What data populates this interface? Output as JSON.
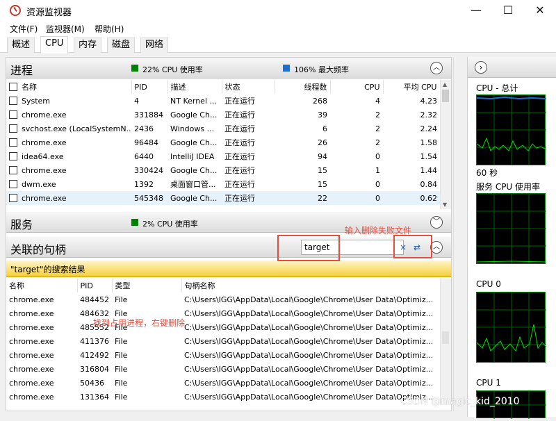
{
  "window": {
    "title": "资源监视器",
    "minimize": "—",
    "maximize": "☐",
    "close": "✕"
  },
  "menu": [
    "文件(F)",
    "监视器(M)",
    "帮助(H)"
  ],
  "tabs": [
    "概述",
    "CPU",
    "内存",
    "磁盘",
    "网络"
  ],
  "active_tab": "CPU",
  "process": {
    "title": "进程",
    "legend1": "22% CPU 使用率",
    "legend2": "106% 最大频率",
    "columns": [
      "名称",
      "PID",
      "描述",
      "状态",
      "线程数",
      "CPU",
      "平均 CPU"
    ],
    "rows": [
      [
        "System",
        "4",
        "NT Kernel ...",
        "正在运行",
        "268",
        "4",
        "4.23"
      ],
      [
        "chrome.exe",
        "331884",
        "Google Ch...",
        "正在运行",
        "39",
        "2",
        "2.32"
      ],
      [
        "svchost.exe (LocalSystemN...",
        "2436",
        "Windows ...",
        "正在运行",
        "6",
        "2",
        "2.24"
      ],
      [
        "chrome.exe",
        "96484",
        "Google Ch...",
        "正在运行",
        "26",
        "2",
        "1.58"
      ],
      [
        "idea64.exe",
        "6440",
        "IntelliJ IDEA",
        "正在运行",
        "94",
        "0",
        "1.54"
      ],
      [
        "chrome.exe",
        "330424",
        "Google Ch...",
        "正在运行",
        "15",
        "1",
        "1.44"
      ],
      [
        "dwm.exe",
        "1392",
        "桌面窗口管...",
        "正在运行",
        "15",
        "0",
        "0.84"
      ],
      [
        "chrome.exe",
        "545348",
        "Google Ch...",
        "正在运行",
        "22",
        "0",
        "0.62"
      ]
    ]
  },
  "services": {
    "title": "服务",
    "legend": "2% CPU 使用率"
  },
  "handles": {
    "title": "关联的句柄",
    "search_value": "target",
    "clear_icon": "×",
    "refresh_icon": "⇄",
    "results_label": "\"target\"的搜索结果",
    "columns": [
      "名称",
      "PID",
      "类型",
      "句柄名称"
    ],
    "rows": [
      [
        "chrome.exe",
        "484452",
        "File",
        "C:\\Users\\IGG\\AppData\\Local\\Google\\Chrome\\User Data\\Optimiz..."
      ],
      [
        "chrome.exe",
        "484632",
        "File",
        "C:\\Users\\IGG\\AppData\\Local\\Google\\Chrome\\User Data\\Optimiz..."
      ],
      [
        "chrome.exe",
        "485552",
        "File",
        "C:\\Users\\IGG\\AppData\\Local\\Google\\Chrome\\User Data\\Optimiz..."
      ],
      [
        "chrome.exe",
        "411376",
        "File",
        "C:\\Users\\IGG\\AppData\\Local\\Google\\Chrome\\User Data\\Optimiz..."
      ],
      [
        "chrome.exe",
        "412492",
        "File",
        "C:\\Users\\IGG\\AppData\\Local\\Google\\Chrome\\User Data\\Optimiz..."
      ],
      [
        "chrome.exe",
        "316804",
        "File",
        "C:\\Users\\IGG\\AppData\\Local\\Google\\Chrome\\User Data\\Optimiz..."
      ],
      [
        "chrome.exe",
        "50436",
        "File",
        "C:\\Users\\IGG\\AppData\\Local\\Google\\Chrome\\User Data\\Optimiz..."
      ],
      [
        "chrome.exe",
        "131364",
        "File",
        "C:\\Users\\IGG\\AppData\\Local\\Google\\Chrome\\User Data\\Optimiz..."
      ]
    ]
  },
  "annotations": {
    "a1": "输入删除失败文件",
    "a2": "找到占用进程，右键删除"
  },
  "right_panel": {
    "expand_icon": "›",
    "labels": [
      "CPU - 总计",
      "60 秒",
      "服务 CPU 使用率",
      "CPU 0",
      "CPU 1"
    ]
  },
  "watermark": "CSDN @magic_kid_2010",
  "colors": {
    "cpu_green": "#008000",
    "freq_blue": "#1e6fd0",
    "annot_red": "#e74c3c",
    "banner_yellow": "#f5cf3a"
  }
}
